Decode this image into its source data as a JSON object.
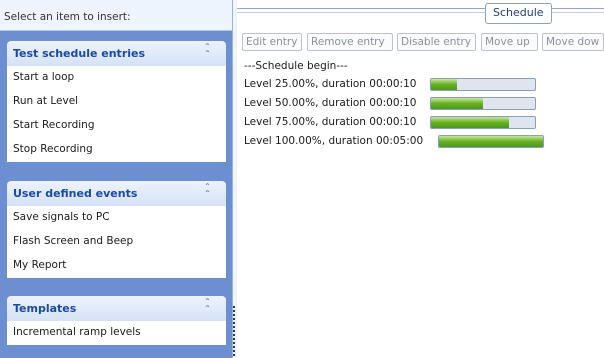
{
  "left_pane": {
    "header": "Select an item to insert:",
    "groups": [
      {
        "title": "Test schedule entries",
        "items": [
          "Start a loop",
          "Run at Level",
          "Start Recording",
          "Stop Recording"
        ]
      },
      {
        "title": "User defined events",
        "items": [
          "Save signals to PC",
          "Flash Screen and Beep",
          "My Report"
        ]
      },
      {
        "title": "Templates",
        "items": [
          "Incremental ramp levels"
        ]
      }
    ]
  },
  "schedule": {
    "title": "Schedule",
    "toolbar": [
      "Edit entry",
      "Remove entry",
      "Disable entry",
      "Move up",
      "Move dow"
    ],
    "begin_label": "---Schedule begin---",
    "entries": [
      {
        "label": "Level 25.00%, duration 00:00:10",
        "progress": 0.25
      },
      {
        "label": "Level 50.00%, duration 00:00:10",
        "progress": 0.5
      },
      {
        "label": "Level 75.00%, duration 00:00:10",
        "progress": 0.75
      },
      {
        "label": "Level 100.00%, duration 00:05:00",
        "progress": 1.0
      }
    ]
  },
  "colors": {
    "pane_background": "#6c8fd1",
    "group_title": "#1a49a6",
    "bar_fill": "#68b024"
  },
  "icons": {
    "group_collapse": "double-chevron-up-icon"
  }
}
